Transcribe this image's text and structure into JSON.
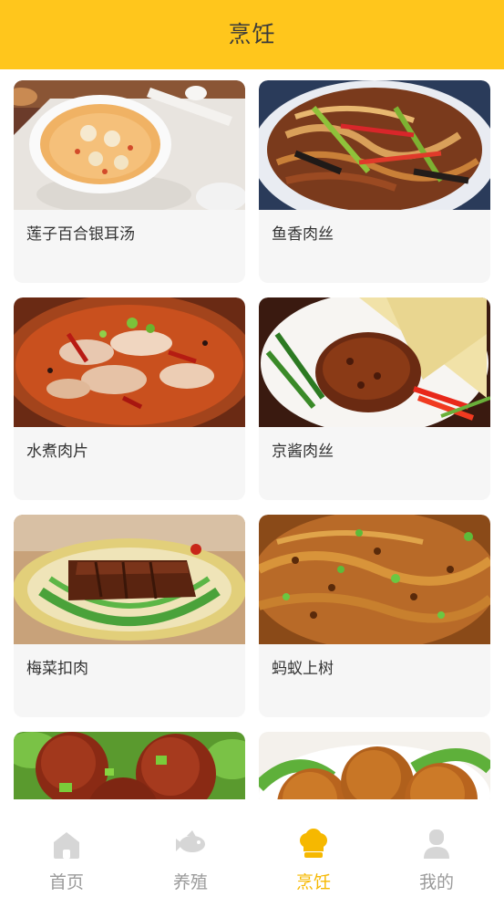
{
  "header": {
    "title": "烹饪"
  },
  "recipes": [
    {
      "name": "莲子百合银耳汤",
      "image": "lotus-lily-soup-photo"
    },
    {
      "name": "鱼香肉丝",
      "image": "yuxiang-pork-photo"
    },
    {
      "name": "水煮肉片",
      "image": "boiled-pork-slices-photo"
    },
    {
      "name": "京酱肉丝",
      "image": "jingjiang-pork-photo"
    },
    {
      "name": "梅菜扣肉",
      "image": "meicai-pork-photo"
    },
    {
      "name": "蚂蚁上树",
      "image": "ants-climbing-tree-photo"
    },
    {
      "name": "",
      "image": "meatball-photo"
    },
    {
      "name": "",
      "image": "lions-head-photo"
    }
  ],
  "tabs": [
    {
      "label": "首页",
      "icon": "home-icon",
      "active": false
    },
    {
      "label": "养殖",
      "icon": "fish-icon",
      "active": false
    },
    {
      "label": "烹饪",
      "icon": "chef-hat-icon",
      "active": true
    },
    {
      "label": "我的",
      "icon": "user-icon",
      "active": false
    }
  ],
  "colors": {
    "accent": "#ffc61c",
    "active_tab": "#f6b800",
    "inactive_tab": "#9a9a9a",
    "card_bg": "#f6f6f6"
  }
}
